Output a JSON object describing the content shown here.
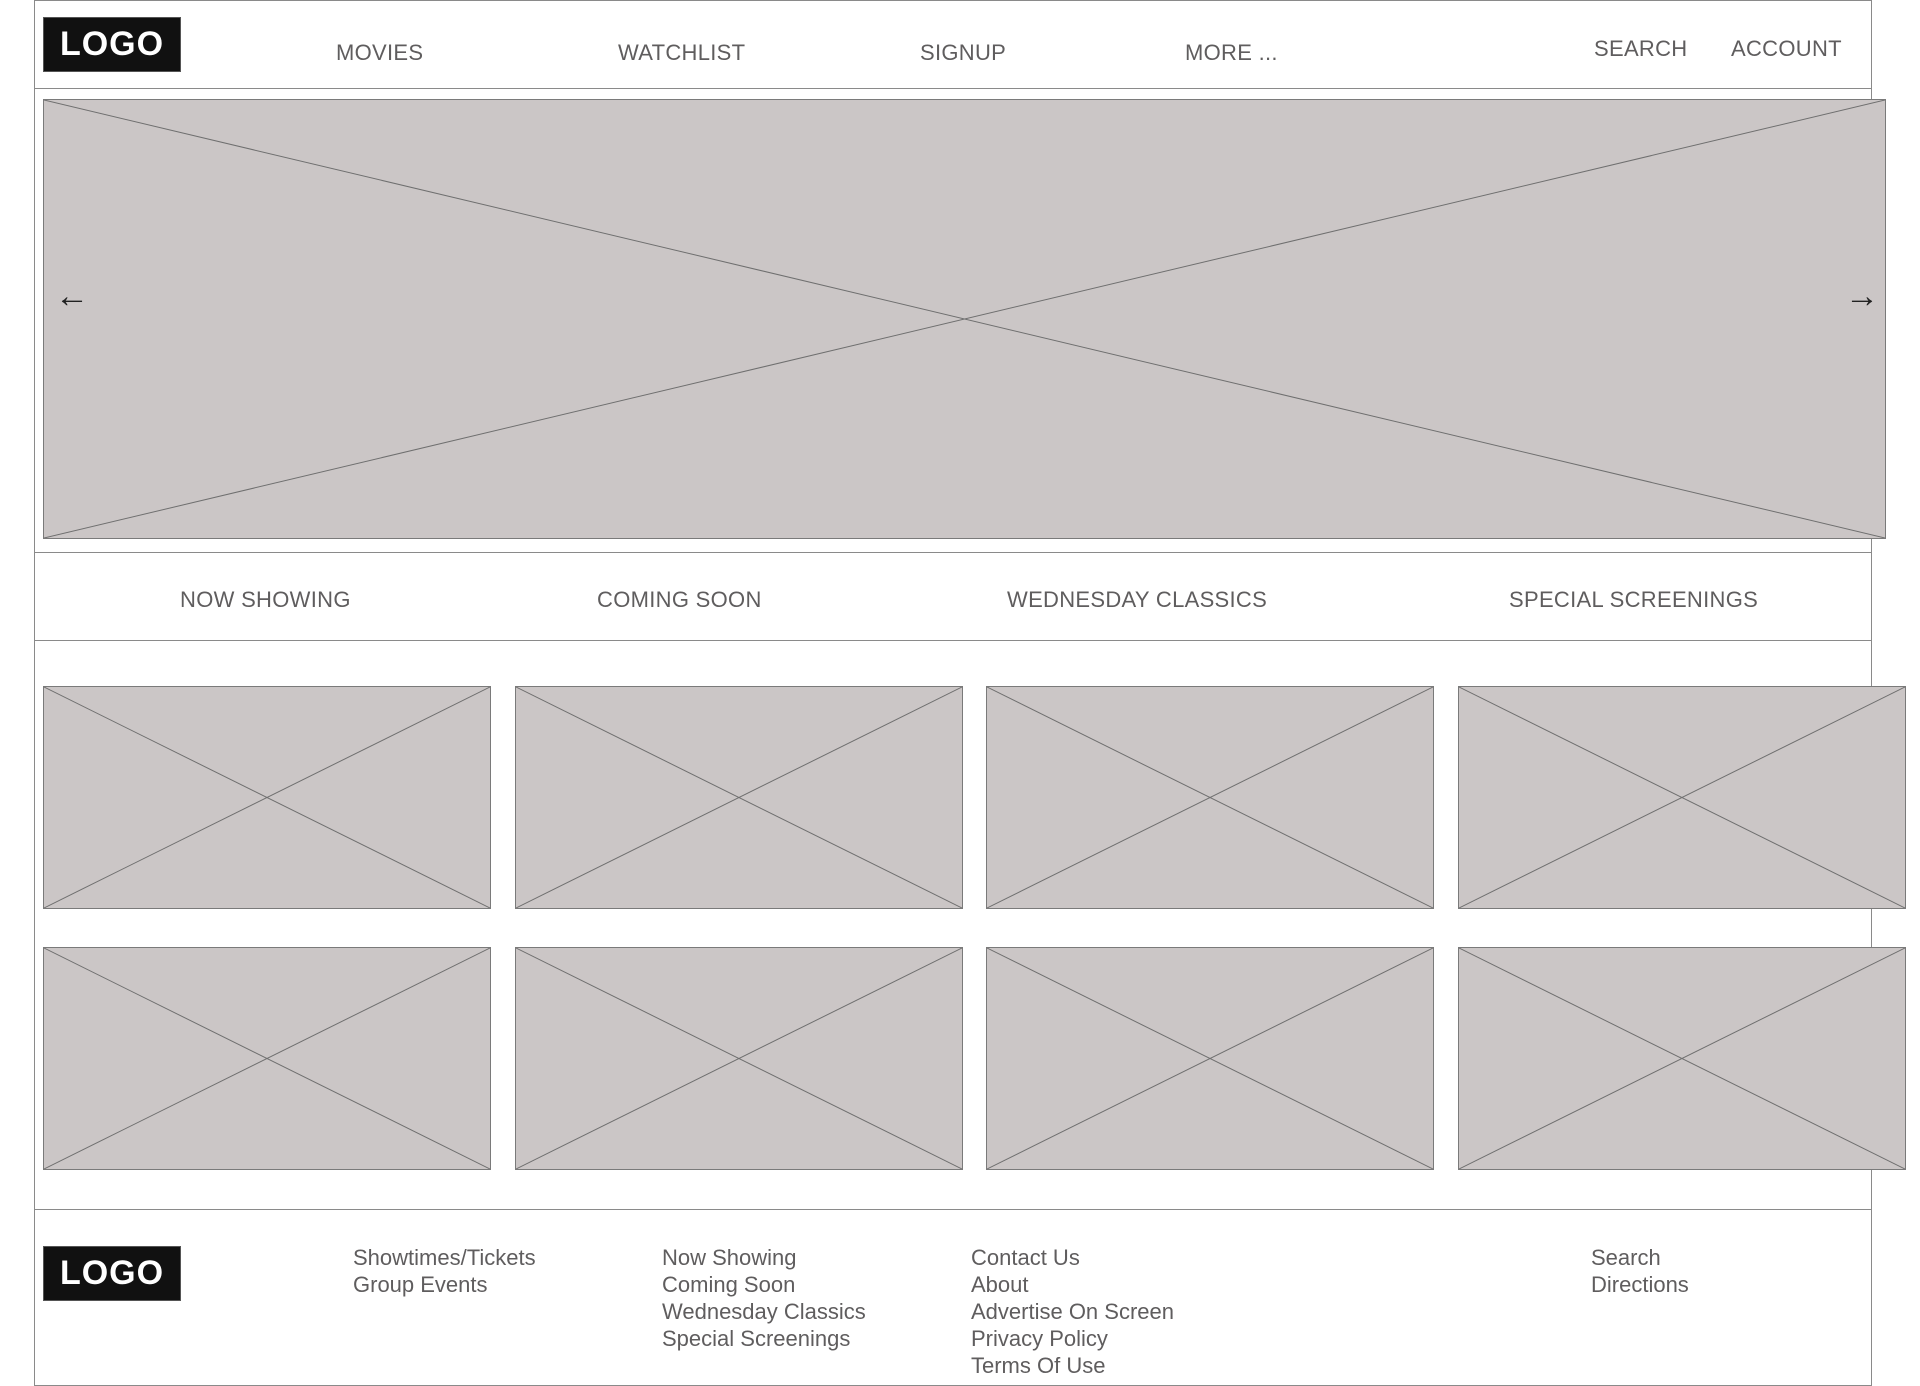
{
  "header": {
    "logo": "LOGO",
    "nav": [
      "MOVIES",
      "WATCHLIST",
      "SIGNUP",
      "MORE ..."
    ],
    "search": "SEARCH",
    "account": "ACCOUNT"
  },
  "hero": {
    "prev_icon": "arrow-left-icon",
    "next_icon": "arrow-right-icon"
  },
  "tabs": [
    "NOW SHOWING",
    "COMING SOON",
    "WEDNESDAY CLASSICS",
    "SPECIAL SCREENINGS"
  ],
  "footer": {
    "logo": "LOGO",
    "columns": [
      [
        "Showtimes/Tickets",
        "Group Events"
      ],
      [
        "Now Showing",
        "Coming Soon",
        "Wednesday Classics",
        "Special Screenings"
      ],
      [
        "Contact Us",
        "About",
        "Advertise On Screen",
        "Privacy Policy",
        "Terms Of Use"
      ],
      [
        "Search",
        "Directions"
      ]
    ]
  },
  "colors": {
    "placeholder_fill": "#cbc6c6",
    "text": "#5f5d5e",
    "logo_bg": "#111111"
  }
}
